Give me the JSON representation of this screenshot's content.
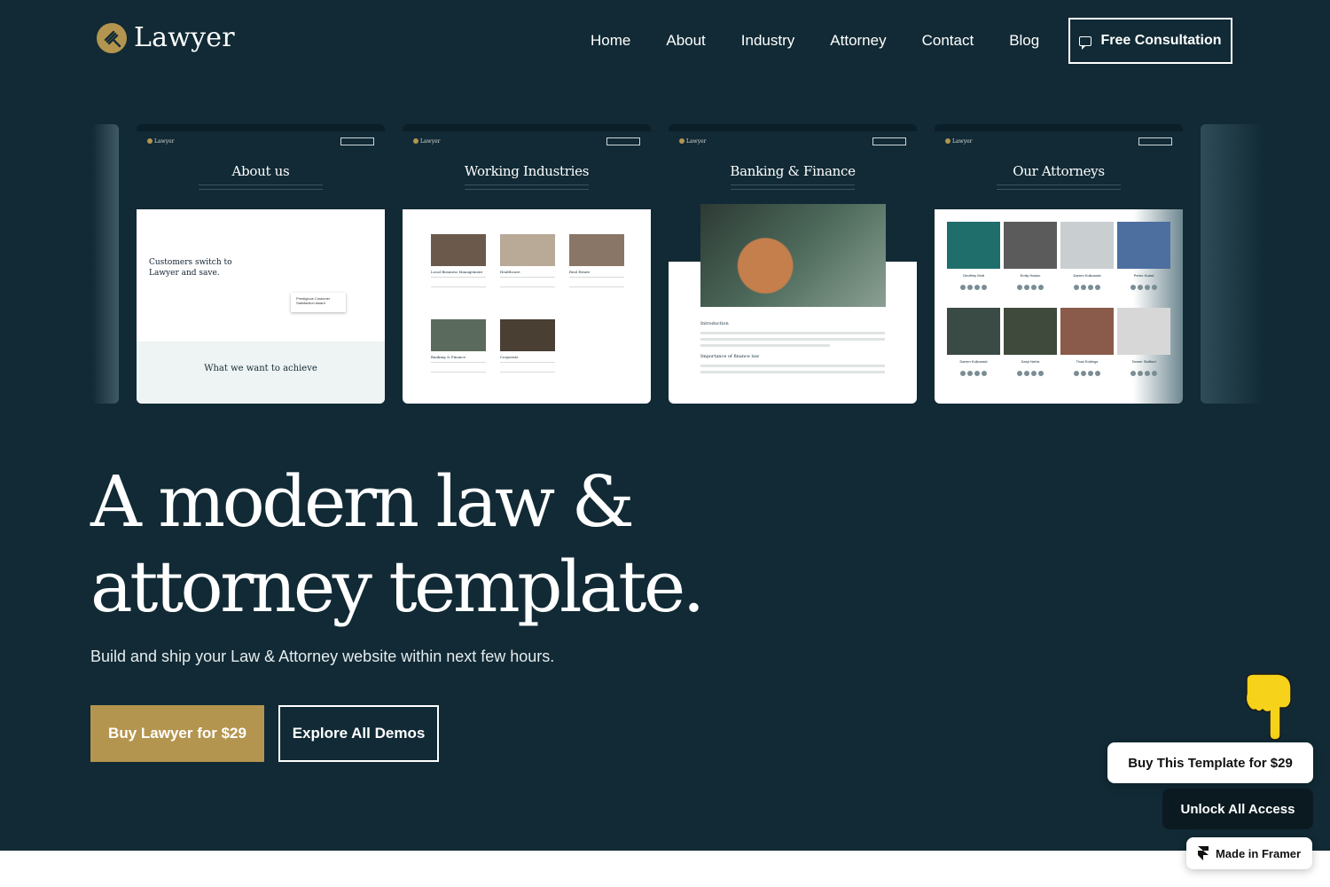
{
  "brand": {
    "name": "Lawyer",
    "accent": "#b4954f",
    "bg": "#112a35"
  },
  "nav": {
    "items": [
      {
        "label": "Home"
      },
      {
        "label": "About"
      },
      {
        "label": "Industry"
      },
      {
        "label": "Attorney"
      },
      {
        "label": "Contact"
      },
      {
        "label": "Blog"
      }
    ],
    "cta": "Free Consultation"
  },
  "previews": {
    "about": {
      "title": "About us",
      "tagline": "Customers switch to Lawyer and save.",
      "badge": "Prestigious Customer Satisfaction Award",
      "bottom": "What we want to achieve"
    },
    "industries": {
      "title": "Working Industries",
      "items": [
        "Local Business Management",
        "Healthcare",
        "Real Estate",
        "Banking & Finance",
        "Corporate"
      ]
    },
    "banking": {
      "title": "Banking & Finance",
      "h1": "Introduction",
      "h2": "Importance of finance law"
    },
    "attorneys": {
      "title": "Our Attorneys",
      "people": [
        "Geoffrey Mott",
        "Emily Hadon",
        "Darren Kulkowski",
        "Pedro Huard",
        "Darren Kulkowski",
        "Daryl Nehls",
        "Thad Eddings",
        "Tanner Stafford"
      ]
    }
  },
  "hero": {
    "headline_line1": "A modern law &",
    "headline_line2": "attorney template.",
    "subline": "Build and ship your Law & Attorney website within next few hours.",
    "primary_button": "Buy Lawyer for $29",
    "secondary_button": "Explore All Demos"
  },
  "floating": {
    "buy": "Buy This Template for $29",
    "unlock": "Unlock All Access",
    "framer": "Made in Framer"
  }
}
